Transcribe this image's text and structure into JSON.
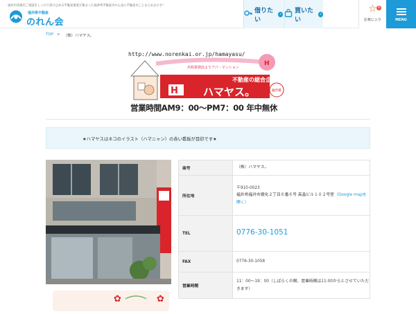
{
  "header": {
    "tagline": "福井の皆様のご相談をしっかり受け止める不動産業者が集まった福井県不動産のれん会に不動産のことならおまかせ！",
    "logo_sub": "福井県不動産",
    "logo_main": "のれん会",
    "nav": [
      {
        "label": "借りたい",
        "icon": "key-icon"
      },
      {
        "label": "買いたい",
        "icon": "bag-icon"
      }
    ],
    "favorites": {
      "label": "お気に入り",
      "count": "0"
    },
    "menu_label": "MENU"
  },
  "breadcrumb": {
    "home": "TOP",
    "separator": ">",
    "current": "（株）ハマヤス。"
  },
  "banner": {
    "url": "http://www.norenkai.or.jp/hamayasu/",
    "title": "不動産の総合企画",
    "company": "ハマヤス。",
    "hours": "営業時間AM9：00～PM7：00 年中無休"
  },
  "catch_text": "★ハマヤスはネコのイラスト（ハマニャン）の赤い看板が目印です★",
  "info": {
    "rows": [
      {
        "label": "商号",
        "value": "（株）ハマヤス。"
      },
      {
        "label": "所在地",
        "zip": "〒910-0023",
        "address": "福井県福井市順化２丁目６番６号 高畠ビル１０２号室",
        "map_link": "（Google mapを開く）"
      },
      {
        "label": "TEL",
        "value": "0776-30-1051"
      },
      {
        "label": "FAX",
        "value": "0776-30-1058"
      },
      {
        "label": "営業時間",
        "value": "11：00～19：00（しばらくの間、営業時間は11:00からとさせていただきます）"
      }
    ]
  },
  "colors": {
    "accent": "#1d9ad8",
    "light_bg": "#eaf6fb",
    "red": "#d8242a"
  }
}
